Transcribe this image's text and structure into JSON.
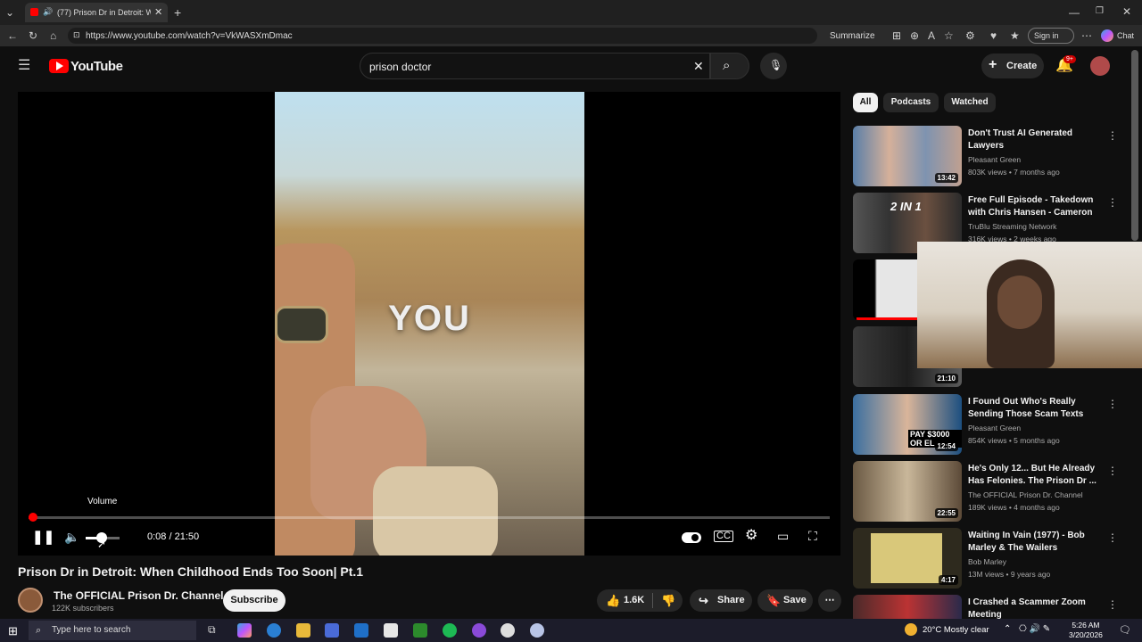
{
  "browser": {
    "tab_title": "(77) Prison Dr in Detroit: Whe",
    "url": "https://www.youtube.com/watch?v=VkWASXmDmac",
    "summarize_label": "Summarize",
    "signin_label": "Sign in",
    "chat_label": "Chat"
  },
  "header": {
    "logo": "YouTube",
    "search_value": "prison doctor",
    "create_label": "Create",
    "notif_badge": "9+"
  },
  "player": {
    "overlay_word": "YOU",
    "volume_tooltip": "Volume",
    "time": "0:08 / 21:50",
    "progress_fraction": 0.006,
    "volume_fraction": 0.45
  },
  "video": {
    "title": "Prison Dr in Detroit: When Childhood Ends Too Soon| Pt.1",
    "channel": "The OFFICIAL Prison Dr. Channel",
    "subscribers": "122K subscribers",
    "subscribe_label": "Subscribe",
    "likes": "1.6K",
    "share_label": "Share",
    "save_label": "Save"
  },
  "sidebar": {
    "chips": [
      "All",
      "Podcasts",
      "Watched"
    ],
    "items": [
      {
        "title": "Don't Trust AI Generated Lawyers",
        "channel": "Pleasant Green",
        "meta": "803K views • 7 months ago",
        "duration": "13:42"
      },
      {
        "title": "Free Full Episode - Takedown with Chris Hansen - Cameron ...",
        "channel": "TruBlu Streaming Network",
        "meta": "316K views • 2 weeks ago",
        "duration": ""
      },
      {
        "title": "",
        "channel": "",
        "meta": "",
        "duration": ""
      },
      {
        "title": "",
        "channel": "",
        "meta": "",
        "duration": "21:10"
      },
      {
        "title": "I Found Out Who's Really Sending Those Scam Texts",
        "channel": "Pleasant Green",
        "meta": "854K views • 5 months ago",
        "duration": "12:54"
      },
      {
        "title": "He's Only 12... But He Already Has Felonies. The Prison Dr ...",
        "channel": "The OFFICIAL Prison Dr. Channel",
        "meta": "189K views • 4 months ago",
        "duration": "22:55"
      },
      {
        "title": "Waiting In Vain (1977) - Bob Marley & The Wailers",
        "channel": "Bob Marley",
        "meta": "13M views • 9 years ago",
        "duration": "4:17"
      },
      {
        "title": "I Crashed a Scammer Zoom Meeting",
        "channel": "",
        "meta": "",
        "duration": ""
      }
    ],
    "thumb_text_1": "2 IN 1",
    "thumb_text_4": "PAY $3000 OR EL"
  },
  "taskbar": {
    "search_placeholder": "Type here to search",
    "weather": "20°C  Mostly clear",
    "time": "5:26 AM",
    "date": "3/20/2026"
  },
  "colors": {
    "accent": "#ff0000",
    "bg": "#0f0f0f",
    "chip_active": "#f1f1f1"
  }
}
